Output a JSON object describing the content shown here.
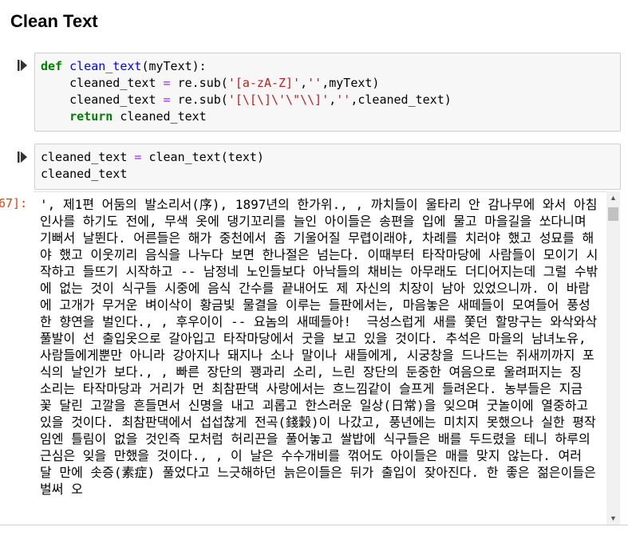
{
  "heading": "Clean Text",
  "cell1": {
    "run_icon": "run-cell-icon",
    "l1_kw": "def",
    "l1_fn": "clean_text",
    "l1_rest": "(myText):",
    "l2_a": "    cleaned_text ",
    "l2_eq": "=",
    "l2_b": " re.sub(",
    "l2_s1": "'[a-zA-Z]'",
    "l2_c": ",",
    "l2_s2": "''",
    "l2_d": ",myText)",
    "l3_a": "    cleaned_text ",
    "l3_eq": "=",
    "l3_b": " re.sub(",
    "l3_s1": "'[\\[\\]\\'\\\"\\\\]'",
    "l3_c": ",",
    "l3_s2": "''",
    "l3_d": ",cleaned_text)",
    "l4_kw": "    return",
    "l4_rest": " cleaned_text"
  },
  "cell2": {
    "run_icon": "run-cell-icon",
    "l1_a": "cleaned_text ",
    "l1_eq": "=",
    "l1_b": " clean_text(text)",
    "l2": "cleaned_text"
  },
  "output": {
    "prompt": "67]:",
    "text": "', 제1편 어둠의 발소리서(序), 1897년의 한가위., , 까치들이 울타리 안 감나무에 와서 아침 인사를 하기도 전에, 무색 옷에 댕기꼬리를 늘인 아이들은 송편을 입에 물고 마을길을 쏘다니며 기뻐서 날뛴다. 어른들은 해가 중천에서 좀 기울어질 무렵이래야, 차례를 치러야 했고 성묘를 해야 했고 이웃끼리 음식을 나누다 보면 한나절은 넘는다. 이때부터 타작마당에 사람들이 모이기 시작하고 들뜨기 시작하고 -- 남정네 노인들보다 아낙들의 채비는 아무래도 더디어지는데 그럴 수밖에 없는 것이 식구들 시중에 음식 간수를 끝내어도 제 자신의 치장이 남아 있었으니까. 이 바람에 고개가 무거운 벼이삭이 황금빛 물결을 이루는 들판에서는, 마음놓은 새떼들이 모여들어 풍성한 향연을 벌인다., , 후우이이 -- 요놈의 새떼들아!  극성스럽게 새를 쫓던 할망구는 와삭와삭 풀발이 선 출입옷으로 갈아입고 타작마당에서 굿을 보고 있을 것이다. 추석은 마을의 남녀노유, 사람들에게뿐만 아니라 강아지나 돼지나 소나 말이나 새들에게, 시궁창을 드나드는 쥐새끼까지 포식의 날인가 보다., , 빠른 장단의 꽹과리 소리, 느린 장단의 둔중한 여음으로 울려퍼지는 징 소리는 타작마당과 거리가 먼 최참판댁 사랑에서는 흐느낌같이 슬프게 들려온다. 농부들은 지금 꽃 달린 고깔을 흔들면서 신명을 내고 괴롭고 한스러운 일상(日常)을 잊으며 굿놀이에 열중하고 있을 것이다. 최참판댁에서 섭섭찮게 전곡(錢穀)이 나갔고, 풍년에는 미치지 못했으나 실한 평작임엔 틀림이 없을 것인즉 모처럼 허리끈을 풀어놓고 쌀밥에 식구들은 배를 두드렸을 테니 하루의 근심은 잊을 만했을 것이다., , 이 날은 수수개비를 꺾어도 아이들은 매를 맞지 않는다. 여러 달 만에 솟증(素症) 풀었다고 느긋해하던 늙은이들은 뒤가 출입이 잦아진다. 한 좋은 젊은이들은 벌써 오"
  }
}
